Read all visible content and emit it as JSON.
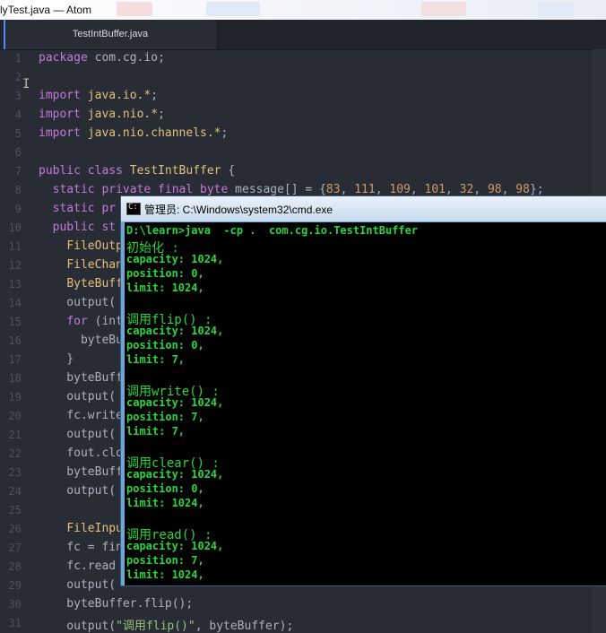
{
  "window": {
    "title": "lyTest.java — Atom"
  },
  "tab": {
    "label": "TestIntBuffer.java"
  },
  "editor": {
    "lines": [
      {
        "n": "1",
        "segs": [
          [
            "kw",
            "package"
          ],
          [
            "pl",
            " com.cg.io;"
          ]
        ]
      },
      {
        "n": "2",
        "segs": []
      },
      {
        "n": "3",
        "segs": [
          [
            "kw",
            "import"
          ],
          [
            "pl",
            " "
          ],
          [
            "ty",
            "java.io.*"
          ],
          [
            "pl",
            ";"
          ]
        ]
      },
      {
        "n": "4",
        "segs": [
          [
            "kw",
            "import"
          ],
          [
            "pl",
            " "
          ],
          [
            "ty",
            "java.nio.*"
          ],
          [
            "pl",
            ";"
          ]
        ]
      },
      {
        "n": "5",
        "segs": [
          [
            "kw",
            "import"
          ],
          [
            "pl",
            " "
          ],
          [
            "ty",
            "java.nio.channels.*"
          ],
          [
            "pl",
            ";"
          ]
        ]
      },
      {
        "n": "6",
        "segs": []
      },
      {
        "n": "7",
        "segs": [
          [
            "kw",
            "public class"
          ],
          [
            "pl",
            " "
          ],
          [
            "ty",
            "TestIntBuffer"
          ],
          [
            "pl",
            " {"
          ]
        ]
      },
      {
        "n": "8",
        "segs": [
          [
            "pl",
            "  "
          ],
          [
            "kw",
            "static private final"
          ],
          [
            "pl",
            " "
          ],
          [
            "kw",
            "byte"
          ],
          [
            "pl",
            " message[] = {"
          ],
          [
            "num",
            "83"
          ],
          [
            "pl",
            ", "
          ],
          [
            "num",
            "111"
          ],
          [
            "pl",
            ", "
          ],
          [
            "num",
            "109"
          ],
          [
            "pl",
            ", "
          ],
          [
            "num",
            "101"
          ],
          [
            "pl",
            ", "
          ],
          [
            "num",
            "32"
          ],
          [
            "pl",
            ", "
          ],
          [
            "num",
            "98"
          ],
          [
            "pl",
            ", "
          ],
          [
            "num",
            "98"
          ],
          [
            "pl",
            "};"
          ]
        ]
      },
      {
        "n": "9",
        "segs": [
          [
            "pl",
            "  "
          ],
          [
            "kw",
            "static pr"
          ]
        ]
      },
      {
        "n": "10",
        "segs": [
          [
            "pl",
            "  "
          ],
          [
            "kw",
            "public st"
          ]
        ]
      },
      {
        "n": "11",
        "segs": [
          [
            "pl",
            "    "
          ],
          [
            "ty",
            "FileOutp"
          ]
        ]
      },
      {
        "n": "12",
        "segs": [
          [
            "pl",
            "    "
          ],
          [
            "ty",
            "FileChan"
          ]
        ]
      },
      {
        "n": "13",
        "segs": [
          [
            "pl",
            "    "
          ],
          [
            "ty",
            "ByteBuff"
          ]
        ]
      },
      {
        "n": "14",
        "segs": [
          [
            "pl",
            "    output("
          ]
        ]
      },
      {
        "n": "15",
        "segs": [
          [
            "pl",
            "    "
          ],
          [
            "kw",
            "for"
          ],
          [
            "pl",
            " (int"
          ]
        ]
      },
      {
        "n": "16",
        "segs": [
          [
            "pl",
            "      byteBu"
          ]
        ]
      },
      {
        "n": "17",
        "segs": [
          [
            "pl",
            "    }"
          ]
        ]
      },
      {
        "n": "18",
        "segs": [
          [
            "pl",
            "    byteBuff"
          ]
        ]
      },
      {
        "n": "19",
        "segs": [
          [
            "pl",
            "    output("
          ]
        ]
      },
      {
        "n": "20",
        "segs": [
          [
            "pl",
            "    fc.write"
          ]
        ]
      },
      {
        "n": "21",
        "segs": [
          [
            "pl",
            "    output("
          ]
        ]
      },
      {
        "n": "22",
        "segs": [
          [
            "pl",
            "    fout.clo"
          ]
        ]
      },
      {
        "n": "23",
        "segs": [
          [
            "pl",
            "    byteBuff"
          ]
        ]
      },
      {
        "n": "24",
        "segs": [
          [
            "pl",
            "    output("
          ]
        ]
      },
      {
        "n": "25",
        "segs": []
      },
      {
        "n": "26",
        "segs": [
          [
            "pl",
            "    "
          ],
          [
            "ty",
            "FileInpu"
          ]
        ]
      },
      {
        "n": "27",
        "segs": [
          [
            "pl",
            "    fc = fin"
          ]
        ]
      },
      {
        "n": "28",
        "segs": [
          [
            "pl",
            "    fc.read"
          ]
        ]
      },
      {
        "n": "29",
        "segs": [
          [
            "pl",
            "    output("
          ]
        ]
      },
      {
        "n": "30",
        "segs": [
          [
            "pl",
            "    byteBuffer.flip();"
          ]
        ]
      },
      {
        "n": "31",
        "segs": [
          [
            "pl",
            "    output("
          ],
          [
            "str",
            "\"调用flip()\""
          ],
          [
            "pl",
            ", byteBuffer);"
          ]
        ]
      }
    ]
  },
  "cmd": {
    "title": "管理员: C:\\Windows\\system32\\cmd.exe",
    "icon": "console-icon",
    "lines": [
      {
        "t": "D:\\learn>java  -cp .  com.cg.io.TestIntBuffer",
        "zh": false
      },
      {
        "t": "初始化 :",
        "zh": true
      },
      {
        "t": "capacity: 1024,",
        "zh": false
      },
      {
        "t": "position: 0,",
        "zh": false
      },
      {
        "t": "limit: 1024,",
        "zh": false
      },
      {
        "t": "",
        "zh": false
      },
      {
        "t": "调用flip() :",
        "zh": true
      },
      {
        "t": "capacity: 1024,",
        "zh": false
      },
      {
        "t": "position: 0,",
        "zh": false
      },
      {
        "t": "limit: 7,",
        "zh": false
      },
      {
        "t": "",
        "zh": false
      },
      {
        "t": "调用write() :",
        "zh": true
      },
      {
        "t": "capacity: 1024,",
        "zh": false
      },
      {
        "t": "position: 7,",
        "zh": false
      },
      {
        "t": "limit: 7,",
        "zh": false
      },
      {
        "t": "",
        "zh": false
      },
      {
        "t": "调用clear() :",
        "zh": true
      },
      {
        "t": "capacity: 1024,",
        "zh": false
      },
      {
        "t": "position: 0,",
        "zh": false
      },
      {
        "t": "limit: 1024,",
        "zh": false
      },
      {
        "t": "",
        "zh": false
      },
      {
        "t": "调用read() :",
        "zh": true
      },
      {
        "t": "capacity: 1024,",
        "zh": false
      },
      {
        "t": "position: 7,",
        "zh": false
      },
      {
        "t": "limit: 1024,",
        "zh": false
      }
    ]
  },
  "colors": {
    "editor_bg": "#282c34",
    "console_text": "#27d63a",
    "keyword": "#c678dd",
    "type": "#e5c07b"
  }
}
